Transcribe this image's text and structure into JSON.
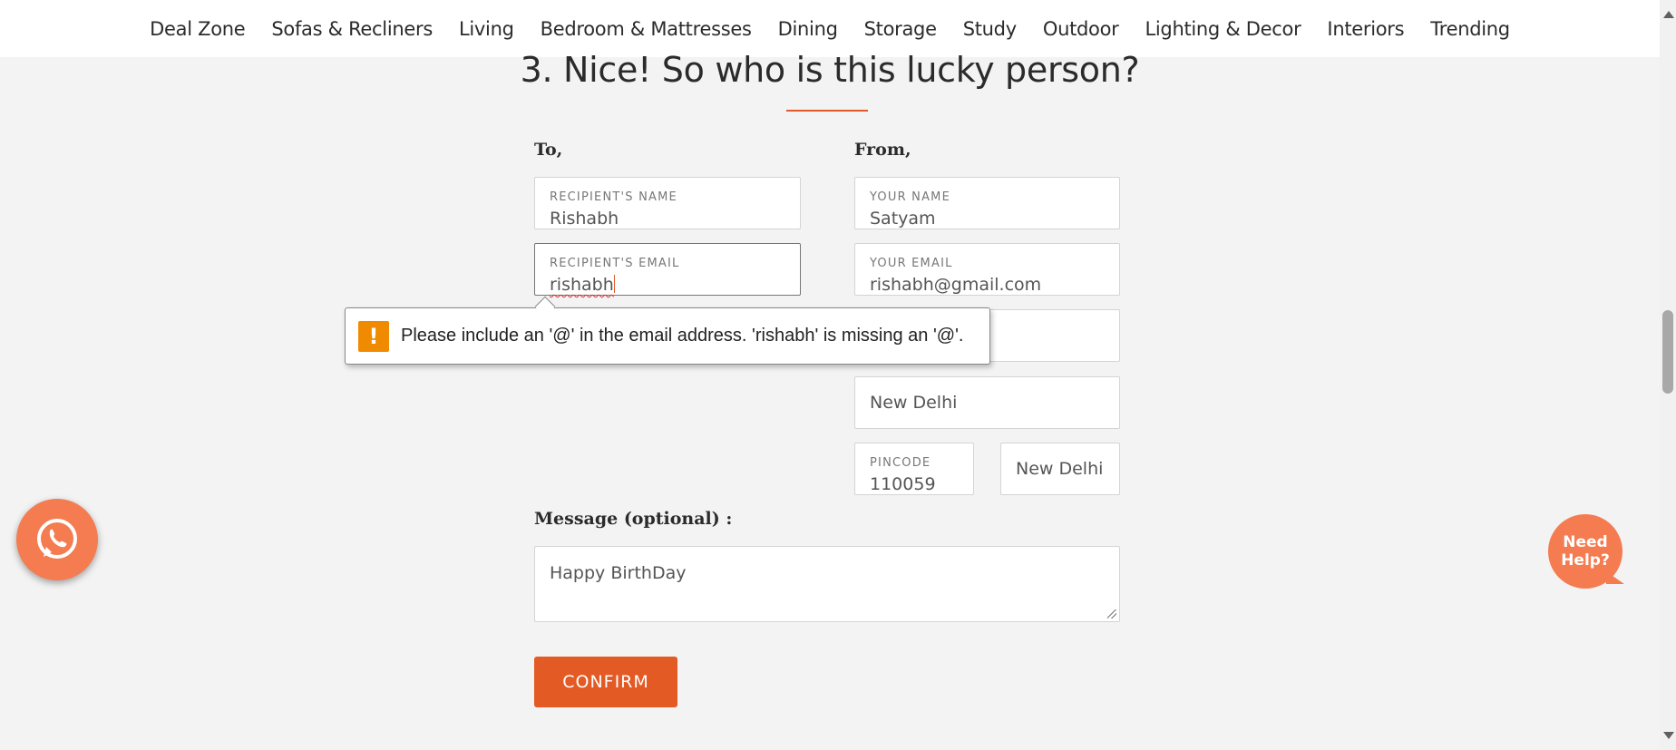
{
  "nav": {
    "items": [
      "Deal Zone",
      "Sofas & Recliners",
      "Living",
      "Bedroom & Mattresses",
      "Dining",
      "Storage",
      "Study",
      "Outdoor",
      "Lighting & Decor",
      "Interiors",
      "Trending"
    ]
  },
  "page": {
    "heading": "3. Nice! So who is this lucky person?"
  },
  "to": {
    "label": "To,",
    "recipient_name_label": "RECIPIENT'S NAME",
    "recipient_name_value": "Rishabh",
    "recipient_email_label": "RECIPIENT'S EMAIL",
    "recipient_email_value": "rishabh"
  },
  "from": {
    "label": "From,",
    "your_name_label": "YOUR NAME",
    "your_name_value": "Satyam",
    "your_email_label": "YOUR EMAIL",
    "your_email_value": "rishabh@gmail.com",
    "city_value": "New Delhi",
    "pincode_label": "PINCODE",
    "pincode_value": "110059",
    "state_value": "New Delhi"
  },
  "validation": {
    "icon": "!",
    "message": "Please include an '@' in the email address. 'rishabh' is missing an '@'."
  },
  "message": {
    "label": "Message (optional) :",
    "value": "Happy BirthDay"
  },
  "actions": {
    "confirm_label": "CONFIRM"
  },
  "help": {
    "label_line1": "Need",
    "label_line2": "Help?"
  },
  "colors": {
    "accent": "#e35a24",
    "floating_button": "#f47c50",
    "warning": "#f08a00"
  }
}
